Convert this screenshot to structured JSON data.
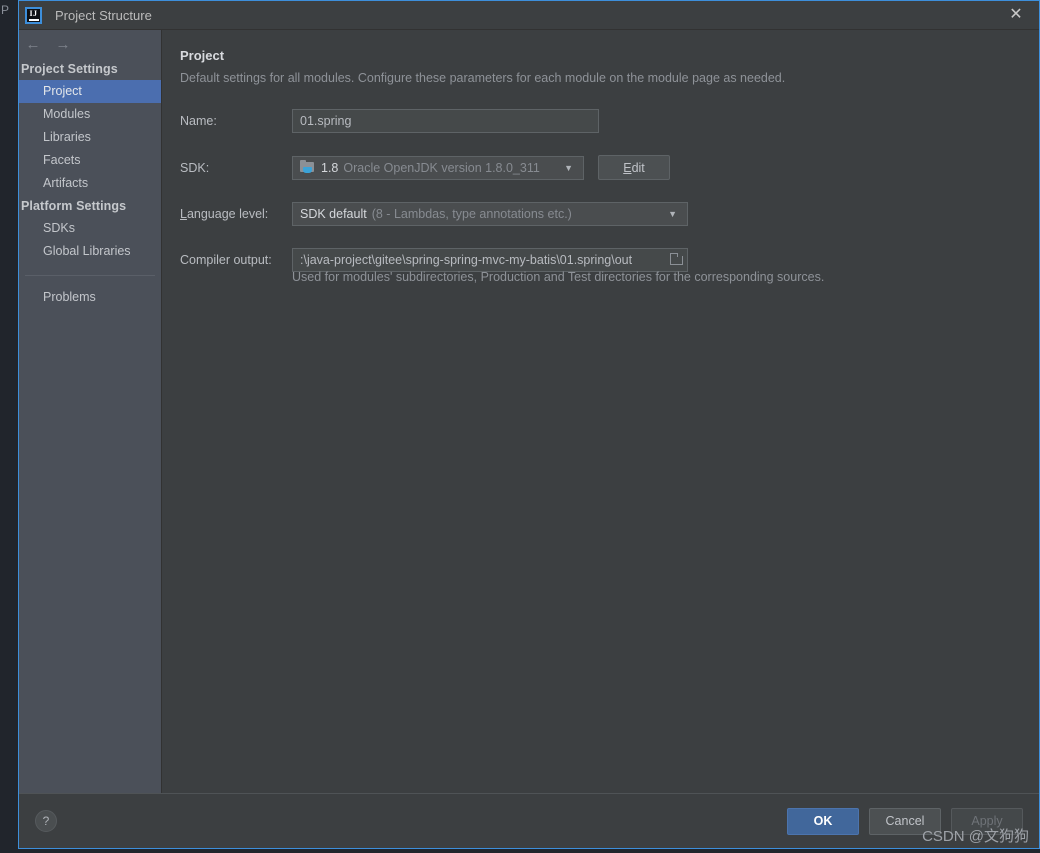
{
  "window": {
    "title": "Project Structure",
    "app_icon": "intellij-idea-icon",
    "close_icon": "✕",
    "background_text": "P",
    "border_color": "#3d8fdb"
  },
  "nav": {
    "back_icon": "←",
    "forward_icon": "→"
  },
  "sidebar": {
    "groups": [
      {
        "label": "Project Settings",
        "items": [
          {
            "label": "Project",
            "selected": true
          },
          {
            "label": "Modules",
            "selected": false
          },
          {
            "label": "Libraries",
            "selected": false
          },
          {
            "label": "Facets",
            "selected": false
          },
          {
            "label": "Artifacts",
            "selected": false
          }
        ]
      },
      {
        "label": "Platform Settings",
        "items": [
          {
            "label": "SDKs",
            "selected": false
          },
          {
            "label": "Global Libraries",
            "selected": false
          }
        ]
      }
    ],
    "extra_items": [
      {
        "label": "Problems",
        "selected": false
      }
    ],
    "selected_color": "#4b6eaf"
  },
  "main": {
    "title": "Project",
    "description": "Default settings for all modules. Configure these parameters for each module on the module page as needed.",
    "fields": {
      "name": {
        "label": "Name:",
        "value": "01.spring",
        "placeholder": ""
      },
      "sdk": {
        "label": "SDK:",
        "icon": "jdk-folder-icon",
        "value_bright": "1.8",
        "value_dim": "Oracle OpenJDK version 1.8.0_311",
        "caret": "▼",
        "edit_button": "Edit",
        "edit_mnemonic": "E"
      },
      "language_level": {
        "label_prefix": "L",
        "label_rest": "anguage level:",
        "value_bright": "SDK default",
        "value_dim": "(8 - Lambdas, type annotations etc.)",
        "caret": "▼"
      },
      "compiler_output": {
        "label": "Compiler output:",
        "value": ":\\java-project\\gitee\\spring-spring-mvc-my-batis\\01.spring\\out",
        "browse_icon": "folder-browse-icon",
        "hint": "Used for modules' subdirectories, Production and Test directories for the corresponding sources."
      }
    }
  },
  "footer": {
    "help_label": "?",
    "ok_label": "OK",
    "cancel_label": "Cancel",
    "apply_label": "Apply",
    "apply_disabled": true,
    "ok_color": "#41679b"
  },
  "watermark": "CSDN @文狗狗"
}
